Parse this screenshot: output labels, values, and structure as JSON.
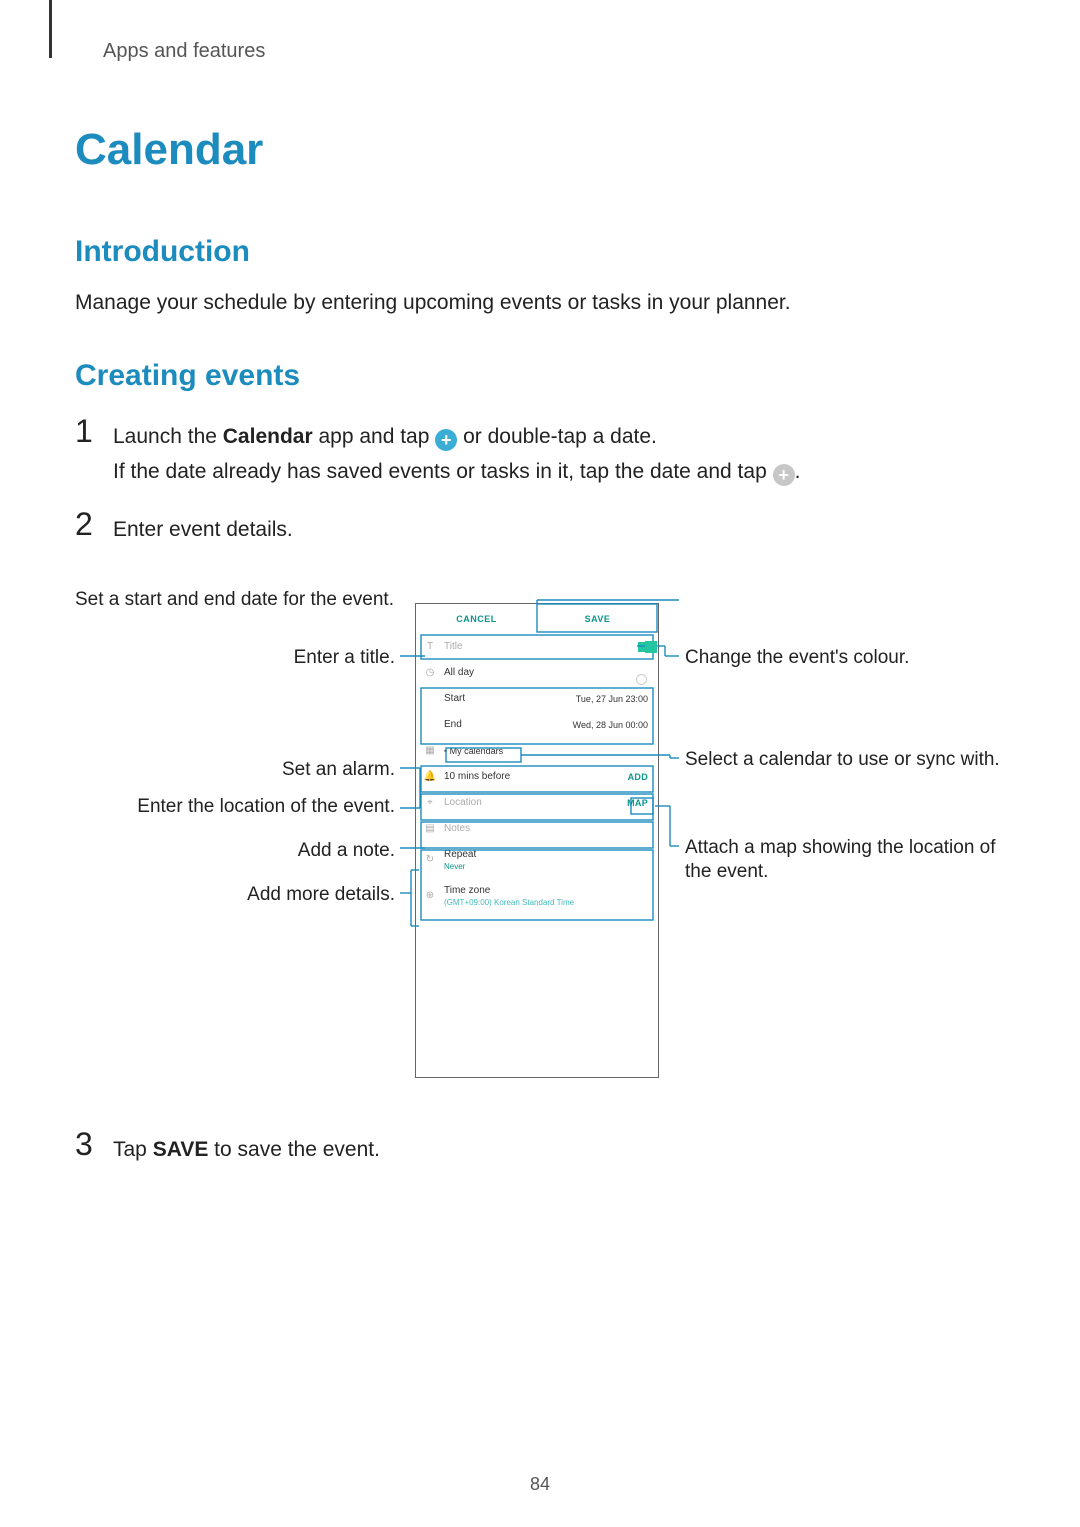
{
  "breadcrumb": "Apps and features",
  "title": "Calendar",
  "intro_heading": "Introduction",
  "intro_text": "Manage your schedule by entering upcoming events or tasks in your planner.",
  "creating_heading": "Creating events",
  "step1_a": "Launch the ",
  "step1_app": "Calendar",
  "step1_b": " app and tap ",
  "step1_c": " or double-tap a date.",
  "step1_line2_a": "If the date already has saved events or tasks in it, tap the date and tap ",
  "step1_line2_b": ".",
  "step2": "Enter event details.",
  "step3_a": "Tap ",
  "step3_bold": "SAVE",
  "step3_b": " to save the event.",
  "page_number": "84",
  "phone": {
    "cancel": "CANCEL",
    "save": "SAVE",
    "title_ph": "Title",
    "allday": "All day",
    "start": "Start",
    "start_val": "Tue, 27 Jun   23:00",
    "end": "End",
    "end_val": "Wed, 28 Jun   00:00",
    "mycal": "My calendars",
    "alarm": "10 mins before",
    "alarm_add": "ADD",
    "location_ph": "Location",
    "location_map": "MAP",
    "notes_ph": "Notes",
    "repeat": "Repeat",
    "repeat_sub": "Never",
    "tz": "Time zone",
    "tz_sub": "(GMT+09:00) Korean Standard Time"
  },
  "callouts": {
    "c_title": "Enter a title.",
    "c_alarm": "Set an alarm.",
    "c_location": "Enter the location of the event.",
    "c_notes": "Add a note.",
    "c_more": "Add more details.",
    "c_dates": "Set a start and end date for the event.",
    "c_color": "Change the event's colour.",
    "c_calendar": "Select a calendar to use or sync with.",
    "c_map": "Attach a map showing the location of the event."
  }
}
